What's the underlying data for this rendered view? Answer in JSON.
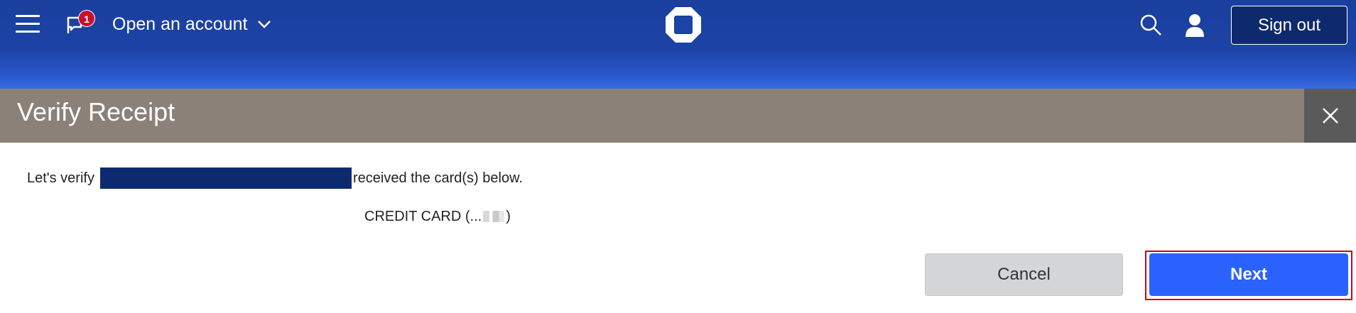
{
  "header": {
    "menu_icon": "hamburger-menu-icon",
    "notification_icon": "flag-notification-icon",
    "notification_count": "1",
    "open_account_label": "Open an account",
    "logo_icon": "chase-octagon-logo",
    "search_icon": "search-icon",
    "profile_icon": "user-profile-icon",
    "sign_out_label": "Sign out",
    "bar_color": "#1c43a6"
  },
  "dialog": {
    "title": "Verify Receipt",
    "close_icon": "close-icon",
    "title_bar_color": "#8b8178",
    "message_prefix": "Let's verify",
    "message_suffix": "received the card(s) below.",
    "card_label_prefix": "CREDIT CARD (...",
    "card_label_suffix": ")",
    "cancel_label": "Cancel",
    "next_label": "Next",
    "next_color": "#2962ff"
  }
}
